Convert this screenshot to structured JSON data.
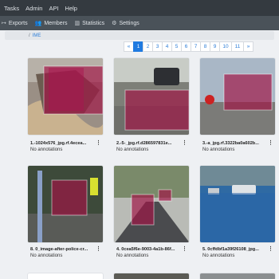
{
  "topnav": {
    "items": [
      "Tasks",
      "Admin",
      "API",
      "Help"
    ]
  },
  "subnav": {
    "items": [
      {
        "label": "Exports",
        "icon": "export-icon"
      },
      {
        "label": "Members",
        "icon": "members-icon"
      },
      {
        "label": "Statistics",
        "icon": "statistics-icon"
      },
      {
        "label": "Settings",
        "icon": "settings-icon"
      }
    ]
  },
  "breadcrumb": {
    "sep": "/",
    "current": "IME"
  },
  "pagination": {
    "prev": "«",
    "next": "»",
    "pages": [
      "1",
      "2",
      "3",
      "4",
      "5",
      "6",
      "7",
      "8",
      "9",
      "10",
      "11"
    ],
    "active": "1"
  },
  "cards": [
    {
      "caption": "1.-1024x576_jpg.rf.4ecea...",
      "annotations": "No annotations"
    },
    {
      "caption": "2.-5-_jpg.rf.d286597831e...",
      "annotations": "No annotations"
    },
    {
      "caption": "3.-a_jpg.rf.3322ba0a602b...",
      "annotations": "No annotations"
    },
    {
      "caption": "8. 0_image-after-police-cr...",
      "annotations": "No annotations"
    },
    {
      "caption": "4. 0cea5f6e-9003-4a1b-86f...",
      "annotations": "No annotations"
    },
    {
      "caption": "5. 0cffdbf1a39f26108_jpg...",
      "annotations": "No annotations"
    }
  ],
  "menu_glyph": "⋮"
}
